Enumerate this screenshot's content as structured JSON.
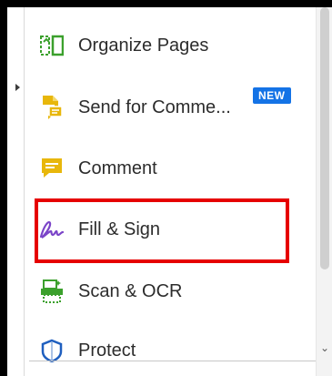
{
  "tools": [
    {
      "label": "Organize Pages",
      "icon": "organize-pages-icon"
    },
    {
      "label": "Send for Comme...",
      "icon": "send-for-comment-icon",
      "badge": "NEW"
    },
    {
      "label": "Comment",
      "icon": "comment-icon"
    },
    {
      "label": "Fill & Sign",
      "icon": "fill-sign-icon",
      "highlighted": true
    },
    {
      "label": "Scan & OCR",
      "icon": "scan-ocr-icon"
    },
    {
      "label": "Protect",
      "icon": "protect-icon"
    }
  ],
  "colors": {
    "organize": "#3ba02c",
    "send": "#e8b70b",
    "comment": "#e8b70b",
    "fill_sign": "#7b45c8",
    "scan": "#3ba02c",
    "protect": "#1f5fbf",
    "badge": "#1473e6",
    "highlight_border": "#e60000"
  }
}
